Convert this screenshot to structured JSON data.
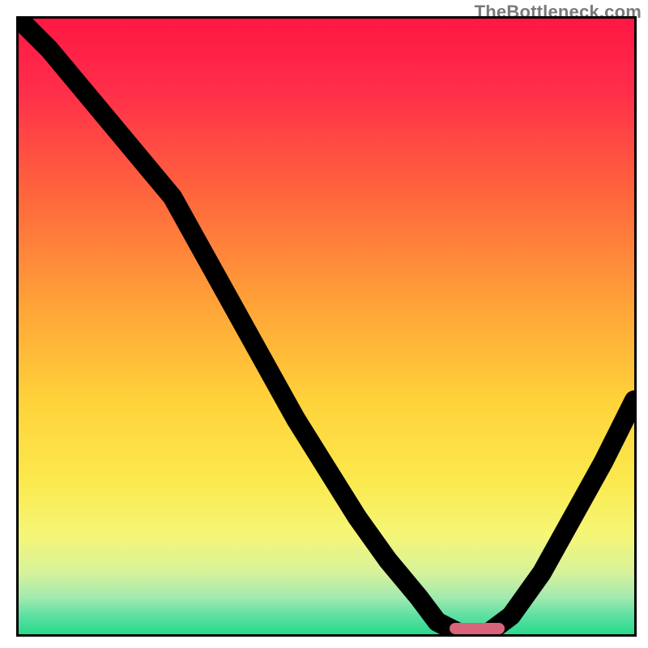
{
  "watermark": "TheBottleneck.com",
  "chart_data": {
    "type": "line",
    "title": "",
    "xlabel": "",
    "ylabel": "",
    "xlim": [
      0,
      100
    ],
    "ylim": [
      0,
      100
    ],
    "grid": false,
    "legend": false,
    "series": [
      {
        "name": "bottleneck-curve",
        "x": [
          0,
          5,
          10,
          15,
          20,
          25,
          30,
          35,
          40,
          45,
          50,
          55,
          60,
          65,
          68,
          72,
          76,
          80,
          85,
          90,
          95,
          100
        ],
        "values": [
          100,
          95,
          89,
          83,
          77,
          71,
          62,
          53,
          44,
          35,
          27,
          19,
          12,
          6,
          2,
          0,
          0,
          3,
          10,
          19,
          28,
          38
        ]
      }
    ],
    "optimal_marker": {
      "x_start": 70,
      "x_end": 79,
      "y": 0,
      "color": "#d9637a"
    },
    "gradient": {
      "stops": [
        {
          "pos": 0.0,
          "color": "#ff1744"
        },
        {
          "pos": 0.12,
          "color": "#ff2f4a"
        },
        {
          "pos": 0.3,
          "color": "#ff6a3c"
        },
        {
          "pos": 0.48,
          "color": "#ffa838"
        },
        {
          "pos": 0.62,
          "color": "#ffd23a"
        },
        {
          "pos": 0.75,
          "color": "#fbe94d"
        },
        {
          "pos": 0.84,
          "color": "#f5f678"
        },
        {
          "pos": 0.9,
          "color": "#d7f29a"
        },
        {
          "pos": 0.94,
          "color": "#a2eab0"
        },
        {
          "pos": 0.97,
          "color": "#5de0a2"
        },
        {
          "pos": 1.0,
          "color": "#28d98c"
        }
      ]
    }
  }
}
